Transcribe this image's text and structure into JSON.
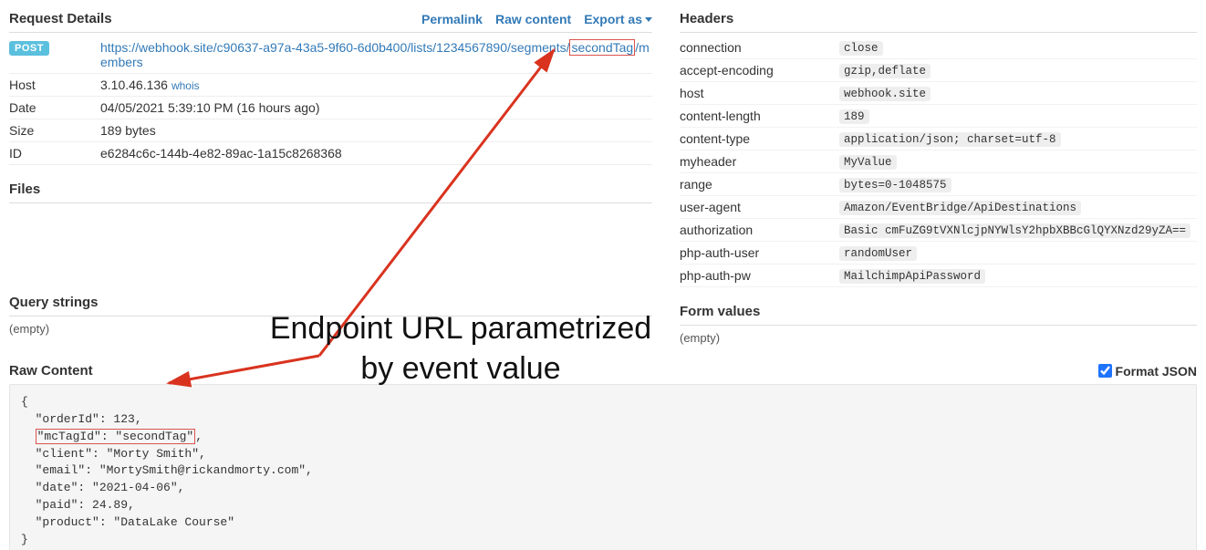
{
  "left": {
    "title": "Request Details",
    "links": {
      "permalink": "Permalink",
      "raw": "Raw content",
      "export": "Export as"
    },
    "method": "POST",
    "url_pre": "https://webhook.site/c90637-a97a-43a5-9f60-6d0b400/lists/1234567890/segments/",
    "url_hl": "secondTag",
    "url_post": "/members",
    "host_label": "Host",
    "host_value": "3.10.46.136",
    "whois": "whois",
    "date_label": "Date",
    "date_value": "04/05/2021 5:39:10 PM (16 hours ago)",
    "size_label": "Size",
    "size_value": "189 bytes",
    "id_label": "ID",
    "id_value": "e6284c6c-144b-4e82-89ac-1a15c8268368",
    "files_title": "Files",
    "query_title": "Query strings",
    "empty": "(empty)"
  },
  "right": {
    "title": "Headers",
    "rows": [
      {
        "k": "connection",
        "v": "close"
      },
      {
        "k": "accept-encoding",
        "v": "gzip,deflate"
      },
      {
        "k": "host",
        "v": "webhook.site"
      },
      {
        "k": "content-length",
        "v": "189"
      },
      {
        "k": "content-type",
        "v": "application/json; charset=utf-8"
      },
      {
        "k": "myheader",
        "v": "MyValue"
      },
      {
        "k": "range",
        "v": "bytes=0-1048575"
      },
      {
        "k": "user-agent",
        "v": "Amazon/EventBridge/ApiDestinations"
      },
      {
        "k": "authorization",
        "v": "Basic cmFuZG9tVXNlcjpNYWlsY2hpbXBBcGlQYXNzd29yZA=="
      },
      {
        "k": "php-auth-user",
        "v": "randomUser"
      },
      {
        "k": "php-auth-pw",
        "v": "MailchimpApiPassword"
      }
    ],
    "form_title": "Form values",
    "empty": "(empty)"
  },
  "raw": {
    "title": "Raw Content",
    "format_label": "Format JSON",
    "body_pre": "{\n  \"orderId\": 123,\n  ",
    "body_hl": "\"mcTagId\": \"secondTag\"",
    "body_post": ",\n  \"client\": \"Morty Smith\",\n  \"email\": \"MortySmith@rickandmorty.com\",\n  \"date\": \"2021-04-06\",\n  \"paid\": 24.89,\n  \"product\": \"DataLake Course\"\n}"
  },
  "annotation": {
    "line1": "Endpoint URL parametrized",
    "line2": "by event value"
  }
}
